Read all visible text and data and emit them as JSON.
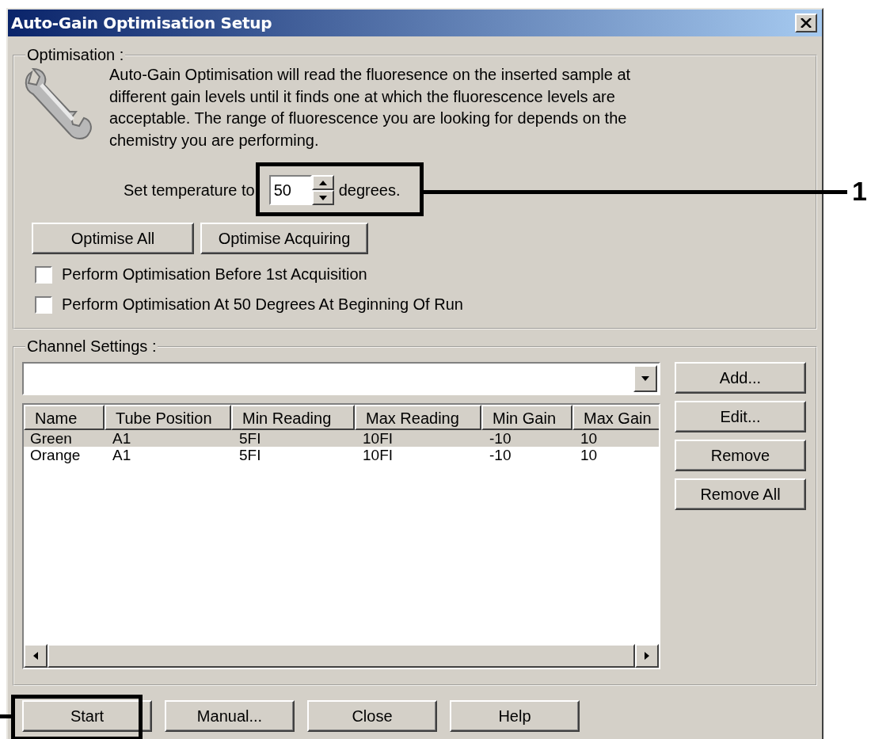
{
  "window": {
    "title": "Auto-Gain Optimisation Setup"
  },
  "optimisation": {
    "legend": "Optimisation :",
    "description": "Auto-Gain Optimisation will read the fluoresence on the inserted sample at different gain levels until it finds one at which the fluorescence levels are acceptable. The range of fluorescence you are looking for depends on the chemistry you are performing.",
    "temperature": {
      "prefix": "Set temperature to",
      "value": "50",
      "suffix": "degrees."
    },
    "buttons": [
      "Optimise All",
      "Optimise Acquiring"
    ],
    "checkboxes": [
      {
        "label": "Perform Optimisation Before 1st Acquisition",
        "checked": false
      },
      {
        "label": "Perform Optimisation At 50 Degrees At Beginning Of Run",
        "checked": false
      }
    ]
  },
  "channel_settings": {
    "legend": "Channel Settings :",
    "columns": [
      "Name",
      "Tube Position",
      "Min Reading",
      "Max Reading",
      "Min Gain",
      "Max Gain"
    ],
    "rows": [
      {
        "cells": [
          "Green",
          "A1",
          "5FI",
          "10FI",
          "-10",
          "10"
        ],
        "selected": true
      },
      {
        "cells": [
          "Orange",
          "A1",
          "5FI",
          "10FI",
          "-10",
          "10"
        ],
        "selected": false
      }
    ],
    "side_buttons": [
      "Add...",
      "Edit...",
      "Remove",
      "Remove All"
    ]
  },
  "buttons": [
    "Start",
    "Manual...",
    "Close",
    "Help"
  ],
  "callouts": [
    {
      "label": "1"
    }
  ]
}
